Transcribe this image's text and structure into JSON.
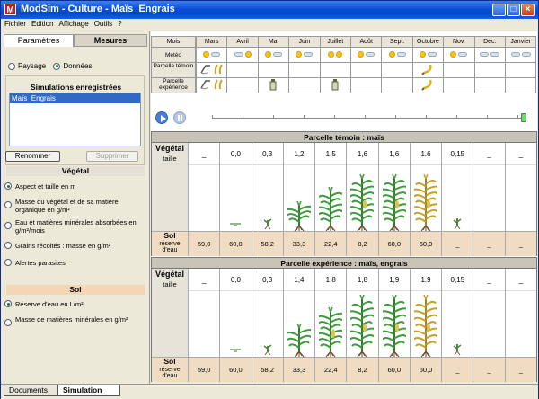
{
  "window": {
    "title": "ModSim - Culture - Maïs_Engrais",
    "app_icon": "M"
  },
  "menu": [
    "Fichier",
    "Edition",
    "Affichage",
    "Outils",
    "?"
  ],
  "left": {
    "tabs": {
      "params": "Paramètres",
      "mesures": "Mesures"
    },
    "view": {
      "paysage": "Paysage",
      "donnees": "Données"
    },
    "sims": {
      "title": "Simulations enregistrées",
      "items": [
        "Maïs_Engrais"
      ]
    },
    "buttons": {
      "rename": "Renommer",
      "delete": "Supprimer"
    },
    "vegetal": {
      "title": "Végétal",
      "options": [
        "Aspect et taille en m",
        "Masse du végétal et de sa matière organique en g/m²",
        "Eau et matières minérales absorbées en g/m²/mois",
        "Grains récoltés : masse en g/m²",
        "Alertes parasites"
      ]
    },
    "sol": {
      "title": "Sol",
      "options": [
        "Réserve d'eau en L/m²",
        "Masse de matières minérales en g/m²"
      ]
    }
  },
  "months": {
    "header": "Mois",
    "names": [
      "Mars",
      "Avril",
      "Mai",
      "Juin",
      "Juillet",
      "Août",
      "Sept.",
      "Octobre",
      "Nov.",
      "Déc.",
      "Janvier"
    ],
    "row_meteo": "Météo",
    "row_temoin": "Parcelle témoin",
    "row_experience": "Parcelle expérience",
    "meteo": [
      "sun,rain",
      "rain,sun",
      "sun,rain",
      "sun,rain",
      "sun,sun",
      "sun,rain",
      "sun,rain",
      "sun,rain",
      "sun,rain",
      "rain,rain",
      "rain,rain"
    ]
  },
  "panel1": {
    "title": "Parcelle témoin : maïs",
    "veg_label": "Végétal",
    "veg_sub": "taille",
    "sol_label": "Sol",
    "sol_sub": "réserve d'eau",
    "taille": [
      "_",
      "0,0",
      "0,3",
      "1,2",
      "1,5",
      "1,6",
      "1,6",
      "1.6",
      "0,15",
      "_",
      "_"
    ],
    "reserve": [
      "59,0",
      "60,0",
      "58,2",
      "33,3",
      "22,4",
      "8,2",
      "60,0",
      "60,0",
      "_",
      "_",
      "_"
    ]
  },
  "panel2": {
    "title": "Parcelle expérience : maïs, engrais",
    "veg_label": "Végétal",
    "veg_sub": "taille",
    "sol_label": "Sol",
    "sol_sub": "réserve d'eau",
    "taille": [
      "_",
      "0,0",
      "0,3",
      "1,4",
      "1,8",
      "1,8",
      "1,9",
      "1.9",
      "0,15",
      "_",
      "_"
    ],
    "reserve": [
      "59,0",
      "60,0",
      "58,2",
      "33,3",
      "22,4",
      "8,2",
      "60,0",
      "60,0",
      "_",
      "_",
      "_"
    ]
  },
  "bottom_tabs": {
    "docs": "Documents",
    "sim": "Simulation"
  }
}
